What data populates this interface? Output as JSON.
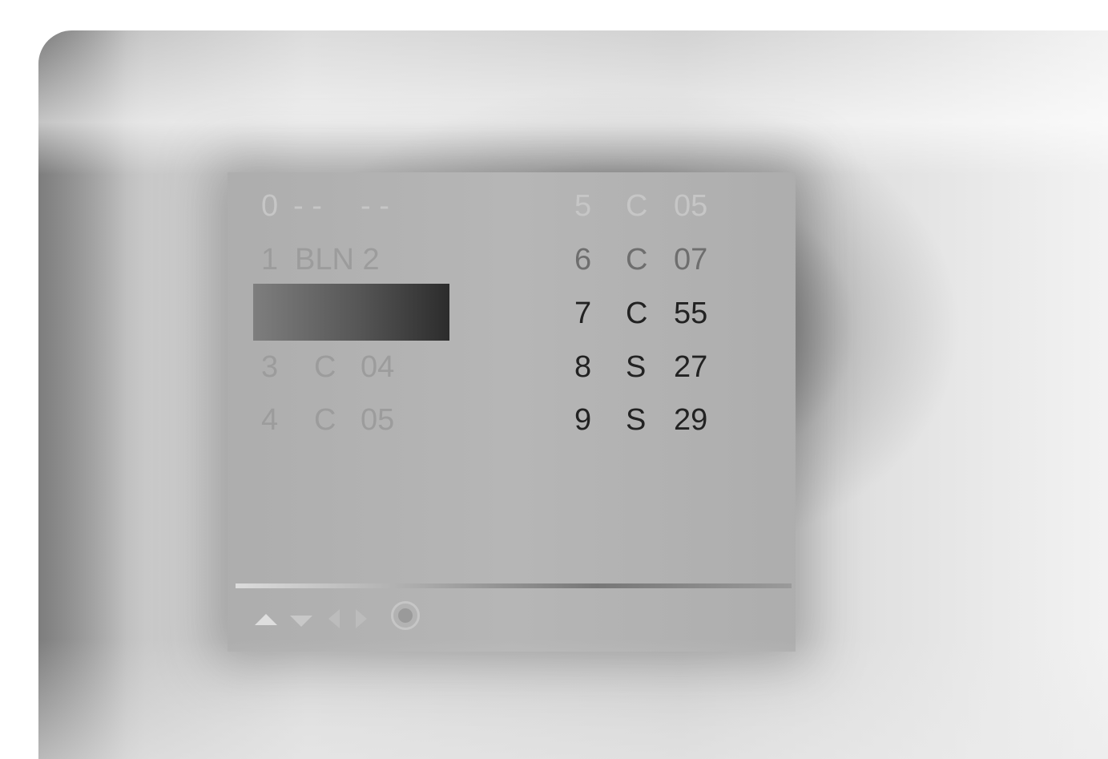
{
  "programme_list": {
    "left_column": [
      {
        "number": "0",
        "system": "- -",
        "channel": "- -"
      },
      {
        "number": "1",
        "system": "BLN 2",
        "channel": ""
      },
      {
        "number": "",
        "system": "",
        "channel": ""
      },
      {
        "number": "3",
        "system": "C",
        "channel": "04"
      },
      {
        "number": "4",
        "system": "C",
        "channel": "05"
      }
    ],
    "right_column": [
      {
        "number": "5",
        "system": "C",
        "channel": "05"
      },
      {
        "number": "6",
        "system": "C",
        "channel": "07"
      },
      {
        "number": "7",
        "system": "C",
        "channel": "55"
      },
      {
        "number": "8",
        "system": "S",
        "channel": "27"
      },
      {
        "number": "9",
        "system": "S",
        "channel": "29"
      }
    ],
    "selected_index": 2
  },
  "controls": [
    {
      "icon": "up-arrow-icon"
    },
    {
      "icon": "down-arrow-icon"
    },
    {
      "icon": "left-arrow-icon"
    },
    {
      "icon": "right-arrow-icon"
    },
    {
      "icon": "enter-button-icon"
    }
  ],
  "colors": {
    "panel": "#b3b3b3",
    "selection": "#3a3a3a"
  }
}
